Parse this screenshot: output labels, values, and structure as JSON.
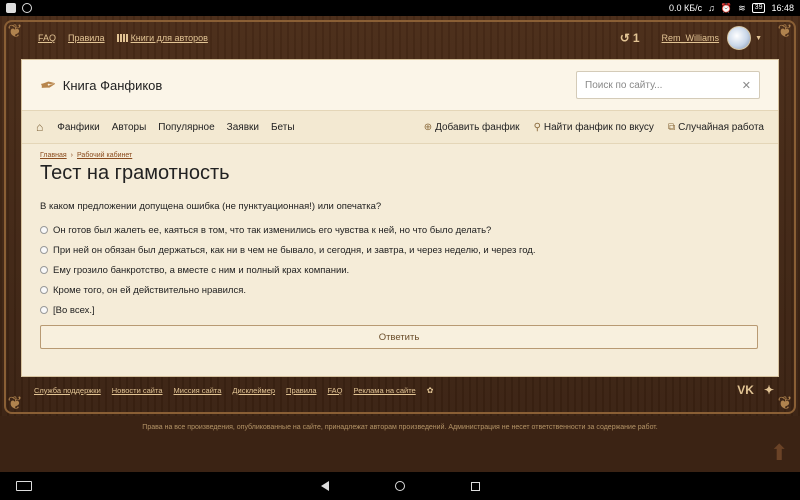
{
  "statusbar": {
    "speed": "0.0 КБ/с",
    "battery": "39",
    "time": "16:48"
  },
  "topnav": {
    "faq": "FAQ",
    "rules": "Правила",
    "books": "Книги для авторов",
    "history_count": "1",
    "username": "Rem_Williams"
  },
  "header": {
    "logo": "Книга Фанфиков",
    "search_placeholder": "Поиск по сайту..."
  },
  "menu": {
    "items": [
      "Фанфики",
      "Авторы",
      "Популярное",
      "Заявки",
      "Беты"
    ],
    "actions": [
      "Добавить фанфик",
      "Найти фанфик по вкусу",
      "Случайная работа"
    ]
  },
  "breadcrumbs": [
    "Главная",
    "Рабочий кабинет"
  ],
  "page": {
    "title": "Тест на грамотность",
    "question": "В каком предложении допущена ошибка (не пунктуационная!) или опечатка?",
    "options": [
      "Он готов был жалеть ее, каяться в том, что так изменились его чувства к ней, но что было делать?",
      "При ней он обязан был держаться, как ни в чем не бывало, и сегодня, и завтра, и через неделю, и через год.",
      "Ему грозило банкротство, а вместе с ним и полный крах компании.",
      "Кроме того, он ей действительно нравился.",
      "[Во всех.]"
    ],
    "submit": "Ответить"
  },
  "footer": {
    "links": [
      "Служба поддержки",
      "Новости сайта",
      "Миссия сайта",
      "Дисклеймер",
      "Правила",
      "FAQ",
      "Реклама на сайте"
    ],
    "social": [
      "VK",
      "Twitter"
    ],
    "copyright": "Права на все произведения, опубликованные на сайте, принадлежат авторам произведений. Администрация не несет ответственности за содержание работ."
  }
}
